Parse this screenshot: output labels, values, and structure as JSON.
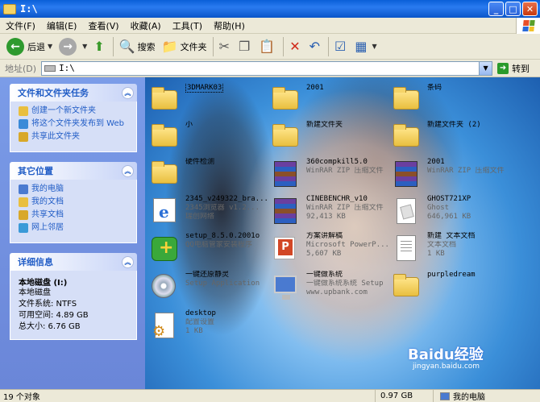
{
  "window": {
    "title": "I:\\"
  },
  "menu": [
    "文件(F)",
    "编辑(E)",
    "查看(V)",
    "收藏(A)",
    "工具(T)",
    "帮助(H)"
  ],
  "toolbar": {
    "back": "后退",
    "search": "搜索",
    "folders": "文件夹"
  },
  "address": {
    "label": "地址(D)",
    "value": "I:\\",
    "go": "转到"
  },
  "tasks": {
    "title": "文件和文件夹任务",
    "items": [
      "创建一个新文件夹",
      "将这个文件夹发布到 Web",
      "共享此文件夹"
    ]
  },
  "places": {
    "title": "其它位置",
    "items": [
      "我的电脑",
      "我的文档",
      "共享文档",
      "网上邻居"
    ]
  },
  "details": {
    "title": "详细信息",
    "name": "本地磁盘 (I:)",
    "type": "本地磁盘",
    "fs": "文件系统: NTFS",
    "free": "可用空间: 4.89 GB",
    "total": "总大小: 6.76 GB"
  },
  "files": [
    {
      "name": "3DMARK03",
      "sub": "",
      "sub2": "",
      "icon": "folder"
    },
    {
      "name": "2001",
      "sub": "",
      "sub2": "",
      "icon": "folder"
    },
    {
      "name": "条码",
      "sub": "",
      "sub2": "",
      "icon": "folder"
    },
    {
      "name": "小",
      "sub": "",
      "sub2": "",
      "icon": "folder"
    },
    {
      "name": "新建文件夹",
      "sub": "",
      "sub2": "",
      "icon": "folder"
    },
    {
      "name": "新建文件夹 (2)",
      "sub": "",
      "sub2": "",
      "icon": "folder"
    },
    {
      "name": "硬件检测",
      "sub": "",
      "sub2": "",
      "icon": "folder"
    },
    {
      "name": "360compkill5.0",
      "sub": "WinRAR ZIP 压缩文件",
      "sub2": "",
      "icon": "rar"
    },
    {
      "name": "2001",
      "sub": "WinRAR ZIP 压缩文件",
      "sub2": "",
      "icon": "rar"
    },
    {
      "name": "2345_v249322_bra...",
      "sub": "2345浏览器 v1.2...",
      "sub2": "瑞创网络",
      "icon": "ie"
    },
    {
      "name": "CINEBENCHR_v10",
      "sub": "WinRAR ZIP 压缩文件",
      "sub2": "92,413 KB",
      "icon": "rar"
    },
    {
      "name": "GHOST721XP",
      "sub": "Ghost",
      "sub2": "646,961 KB",
      "icon": "ghost"
    },
    {
      "name": "setup_8.5.0.2001o",
      "sub": "QQ电脑管家安装程序",
      "sub2": "",
      "icon": "setup"
    },
    {
      "name": "方案讲解稿",
      "sub": "Microsoft PowerP...",
      "sub2": "5,607 KB",
      "icon": "ppt"
    },
    {
      "name": "新建 文本文档",
      "sub": "文本文档",
      "sub2": "1 KB",
      "icon": "doc"
    },
    {
      "name": "一键还原静灵",
      "sub": "Setup Application",
      "sub2": "",
      "icon": "cd"
    },
    {
      "name": "一键做系统",
      "sub": "一键做系统系统 Setup",
      "sub2": "www.upbank.com",
      "icon": "pc"
    },
    {
      "name": "purpledream",
      "sub": "",
      "sub2": "",
      "icon": "folder"
    },
    {
      "name": "desktop",
      "sub": "配置设置",
      "sub2": "1 KB",
      "icon": "gear"
    }
  ],
  "status": {
    "count": "19 个对象",
    "size": "0.97 GB",
    "location": "我的电脑"
  },
  "watermark": {
    "logo": "Baidu经验",
    "url": "jingyan.baidu.com"
  }
}
